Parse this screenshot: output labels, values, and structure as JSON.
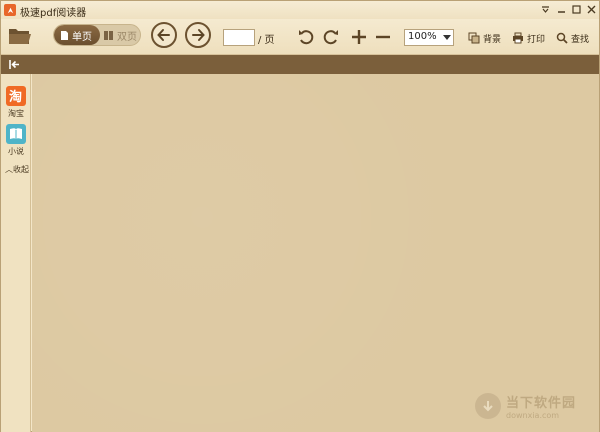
{
  "window": {
    "title": "极速pdf阅读器",
    "controls": [
      "menu-icon",
      "minimize-icon",
      "maximize-icon",
      "close-icon"
    ]
  },
  "toolbar": {
    "view_single_label": "单页",
    "view_double_label": "双页",
    "page_input_value": "",
    "page_suffix": "/ 页",
    "zoom_value": "100%",
    "background_label": "背景",
    "print_label": "打印",
    "find_label": "查找",
    "icons": [
      "open-folder-icon",
      "prev-page-icon",
      "next-page-icon",
      "rotate-left-icon",
      "rotate-right-icon",
      "zoom-in-icon",
      "zoom-out-icon"
    ]
  },
  "sidebar": {
    "items": [
      {
        "label": "淘宝",
        "icon": "taobao-icon",
        "color": "#f06a24"
      },
      {
        "label": "小说",
        "icon": "book-icon",
        "color": "#4fb4c8"
      }
    ],
    "collapse_label": "收起"
  },
  "watermark": {
    "name": "当下软件园",
    "domain": "downxia.com"
  },
  "colors": {
    "accent_brown": "#7b5f3b",
    "canvas": "#ddc9a2",
    "toolbar": "#f2e5c8"
  }
}
